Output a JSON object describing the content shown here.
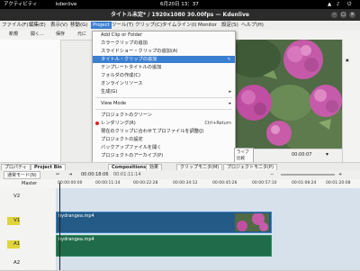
{
  "gnome": {
    "activities": "アクティビティ",
    "app": "kdenlive",
    "clock": "6月20日  13：37"
  },
  "window": {
    "title": "タイトル未定* / 1920x1080 30.00fps — Kdenlive"
  },
  "menubar": [
    "ファイル(F)",
    "編集(E)",
    "表示(V)",
    "移動(G)",
    "Project",
    "ツール(T)",
    "クリップ(C)",
    "タイムライン(I)",
    "Monitor",
    "設定(S)",
    "ヘルプ(H)"
  ],
  "toolbar": [
    "新規",
    "開く...",
    "保存",
    "元に"
  ],
  "project_menu": {
    "items": [
      {
        "label": "Add Clip or Folder",
        "shortcut": "",
        "submenu": false,
        "highlighted": false
      },
      {
        "label": "カラークリップの追加",
        "shortcut": "",
        "submenu": false,
        "highlighted": false
      },
      {
        "label": "スライドショー・クリップの追加(A)",
        "shortcut": "",
        "submenu": false,
        "highlighted": false
      },
      {
        "label": "タイトル・クリップの追加",
        "shortcut": "",
        "submenu": false,
        "highlighted": true
      },
      {
        "label": "テンプレートタイトルの追加",
        "shortcut": "",
        "submenu": false,
        "highlighted": false
      },
      {
        "label": "フォルダの作成(C)",
        "shortcut": "",
        "submenu": false,
        "highlighted": false
      },
      {
        "label": "オンラインリソース",
        "shortcut": "",
        "submenu": false,
        "highlighted": false
      },
      {
        "label": "生成(G)",
        "shortcut": "",
        "submenu": true,
        "highlighted": false
      },
      {
        "label": "View Mode",
        "shortcut": "",
        "submenu": true,
        "highlighted": false
      },
      {
        "label": "プロジェクトのクリーン",
        "shortcut": "",
        "submenu": false,
        "highlighted": false
      },
      {
        "label": "レンダリング(R)",
        "shortcut": "Ctrl+Return",
        "submenu": false,
        "highlighted": false
      },
      {
        "label": "現在のクリップに合わせてプロファイルを調整(J)",
        "shortcut": "",
        "submenu": false,
        "highlighted": false
      },
      {
        "label": "プロジェクトの設定",
        "shortcut": "",
        "submenu": false,
        "highlighted": false
      },
      {
        "label": "バックアップファイルを開く",
        "shortcut": "",
        "submenu": false,
        "highlighted": false
      },
      {
        "label": "プロジェクトのアーカイブ(P)",
        "shortcut": "",
        "submenu": false,
        "highlighted": false
      }
    ]
  },
  "bottom_tabs_left": [
    "プロパティ",
    "Project Bin"
  ],
  "bottom_tabs_center": [
    "Compositions",
    "効果",
    "クリップモニタ(M)"
  ],
  "bottom_tabs_right": [
    "プロジェクトモニタ(P)"
  ],
  "right_panel_text": [
    "ライブ",
    "比較"
  ],
  "monitor": {
    "timecode": "00:00:07"
  },
  "timeline": {
    "mode": "通常モード(N)",
    "timecode": "00:00:18:06",
    "duration": "00:01:11:14",
    "ruler_ticks": [
      "00:00:00:00",
      "00:00:11:14",
      "00:00:22:28",
      "00:00:34:12",
      "00:00:45:26",
      "00:00:57:10",
      "00:01:08:24",
      "00:01:20:08"
    ],
    "master": "Master",
    "tracks": [
      {
        "name": "V2",
        "clip": ""
      },
      {
        "name": "V1",
        "clip": "hydrangea.mp4"
      },
      {
        "name": "A1",
        "clip": "hydrangea.mp4"
      },
      {
        "name": "A2",
        "clip": ""
      }
    ]
  },
  "colors": {
    "accent": "#3b7fd1",
    "video_clip": "#235a86",
    "audio_clip": "#1f6b4a",
    "track_yellow": "#e0d43c"
  }
}
